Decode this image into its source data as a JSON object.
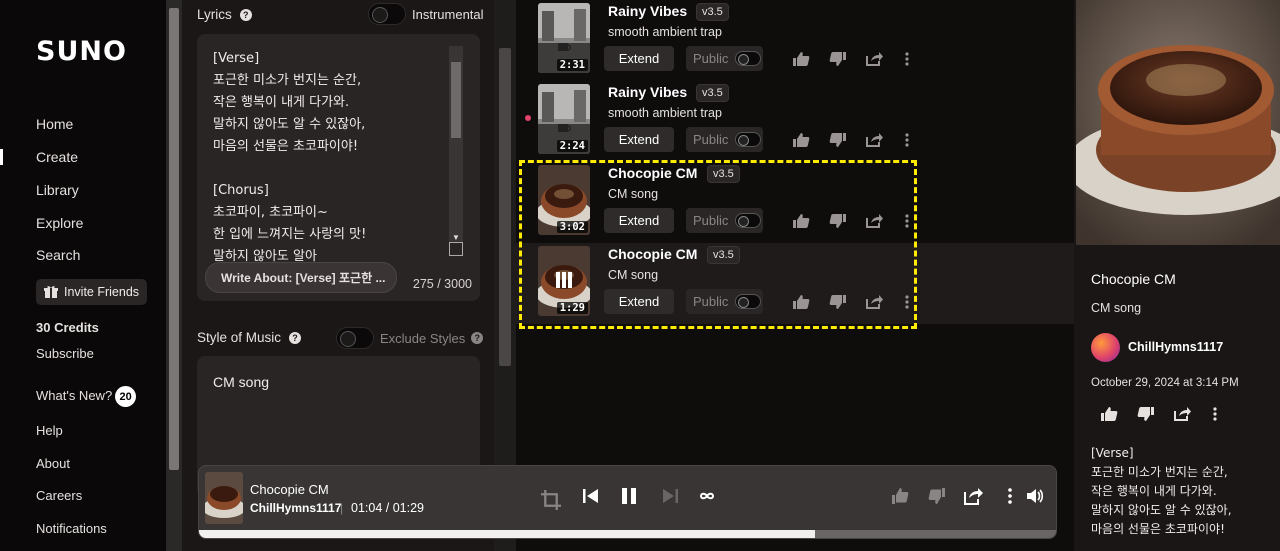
{
  "brand": "SUNO",
  "sidebar": {
    "nav": [
      {
        "label": "Home"
      },
      {
        "label": "Create"
      },
      {
        "label": "Library"
      },
      {
        "label": "Explore"
      },
      {
        "label": "Search"
      }
    ],
    "active": "Create",
    "invite_label": "Invite Friends",
    "credits": "30 Credits",
    "subscribe": "Subscribe",
    "whats_new": "What's New?",
    "whats_new_count": "20",
    "help": "Help",
    "about": "About",
    "careers": "Careers",
    "notifications": "Notifications"
  },
  "create": {
    "lyrics_label": "Lyrics",
    "instrumental_label": "Instrumental",
    "lyrics_text": "[Verse]\n포근한 미소가 번지는 순간,\n작은 행복이 내게 다가와.\n말하지 않아도 알 수 있잖아,\n마음의 선물은 초코파이야!\n\n[Chorus]\n초코파이, 초코파이~\n한 입에 느껴지는 사랑의 맛!\n말하지 않아도 알아",
    "write_about": "Write About: [Verse] 포근한 ...",
    "char_count": "275 / 3000",
    "style_label": "Style of Music",
    "exclude_label": "Exclude Styles",
    "style_value": "CM song"
  },
  "songs": [
    {
      "title": "Rainy Vibes",
      "version": "v3.5",
      "style": "smooth ambient trap",
      "duration": "2:31",
      "extend": "Extend",
      "public": "Public",
      "theme": "rain"
    },
    {
      "title": "Rainy Vibes",
      "version": "v3.5",
      "style": "smooth ambient trap",
      "duration": "2:24",
      "extend": "Extend",
      "public": "Public",
      "theme": "rain"
    },
    {
      "title": "Chocopie CM",
      "version": "v3.5",
      "style": "CM song",
      "duration": "3:02",
      "extend": "Extend",
      "public": "Public",
      "theme": "pie"
    },
    {
      "title": "Chocopie CM",
      "version": "v3.5",
      "style": "CM song",
      "duration": "1:29",
      "extend": "Extend",
      "public": "Public",
      "theme": "pie"
    }
  ],
  "detail": {
    "title": "Chocopie CM",
    "style": "CM song",
    "user": "ChillHymns1117",
    "date": "October 29, 2024 at 3:14 PM",
    "lyrics": "[Verse]\n포근한 미소가 번지는 순간,\n작은 행복이 내게 다가와.\n말하지 않아도 알 수 있잖아,\n마음의 선물은 초코파이야!"
  },
  "player": {
    "title": "Chocopie CM",
    "user": "ChillHymns1117",
    "separator": "|",
    "time": "01:04 / 01:29",
    "progress": 0.717
  },
  "colors": {
    "accent_highlight": "#ffeb00",
    "new_dot": "#e0426a"
  }
}
